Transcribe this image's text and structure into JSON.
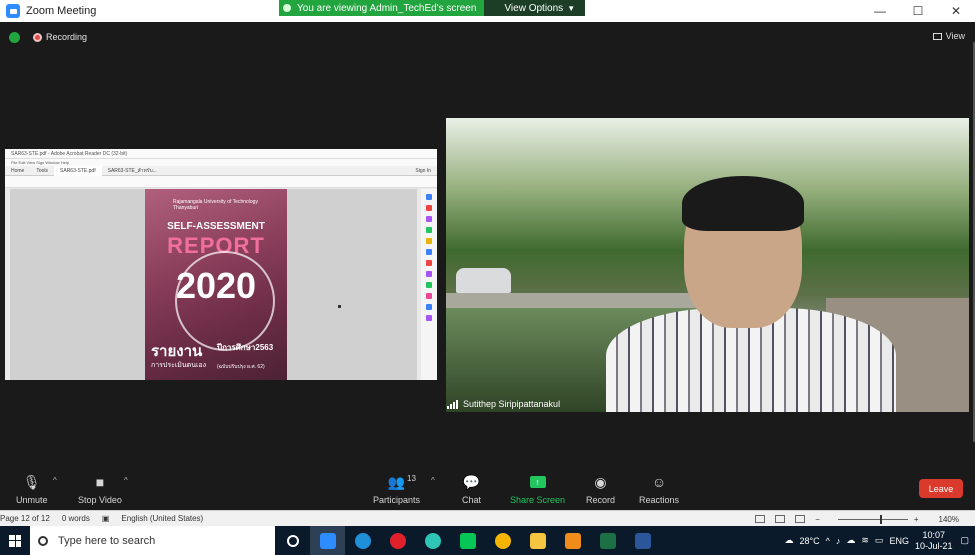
{
  "window": {
    "title": "Zoom Meeting",
    "minimize": "—",
    "maximize": "☐",
    "close": "✕"
  },
  "banner": {
    "message": "You are viewing Admin_TechEd's screen",
    "view_options": "View Options"
  },
  "meeting": {
    "recording": "Recording",
    "view": "View"
  },
  "shared_screen": {
    "acrobat_title": "SAR63-STE.pdf - Adobe Acrobat Reader DC (32-bit)",
    "menu": "File  Edit  View  Sign  Window  Help",
    "tabs": [
      "Home",
      "Tools",
      "SAR63-STE.pdf",
      "SAR63-STE_สำหรับ..."
    ],
    "sign_in": "Sign In",
    "report": {
      "university": "Rajamangala University of Technology Thanyaburi",
      "subtitle": "SELF-ASSESSMENT",
      "title": "REPORT",
      "year": "2020",
      "thai_main": "รายงาน",
      "thai_year": "ปีการศึกษา2563",
      "thai_sub": "การประเมินตนเอง",
      "thai_note": "(ฉบับปรับปรุง ผ.ศ. 62)"
    }
  },
  "video": {
    "participant_name": "Sutithep Siripipattanakul"
  },
  "controls": {
    "unmute": "Unmute",
    "stop_video": "Stop Video",
    "participants": "Participants",
    "participants_count": "13",
    "chat": "Chat",
    "share_screen": "Share Screen",
    "record": "Record",
    "reactions": "Reactions",
    "leave": "Leave"
  },
  "statusbar": {
    "page": "Page 12 of 12",
    "words": "0 words",
    "language": "English (United States)",
    "zoom": "140%"
  },
  "taskbar": {
    "search_placeholder": "Type here to search",
    "weather": "28°C",
    "lang": "ENG",
    "time": "10:07",
    "date": "10-Jul-21"
  },
  "colors": {
    "accent_green": "#22a53f",
    "leave_red": "#d93a2b",
    "zoom_blue": "#2d8cff"
  }
}
